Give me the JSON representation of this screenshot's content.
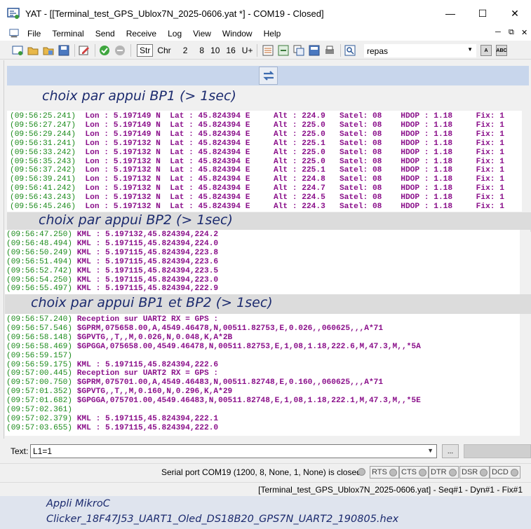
{
  "window": {
    "title": "YAT - [[Terminal_test_GPS_Ublox7N_2025-0606.yat *] - COM19 - Closed]",
    "minimize": "—",
    "maximize": "☐",
    "close": "✕"
  },
  "menu": [
    "File",
    "Terminal",
    "Send",
    "Receive",
    "Log",
    "View",
    "Window",
    "Help"
  ],
  "toolbar": {
    "str": "Str",
    "chr": "Chr",
    "radix": [
      "2",
      "8",
      "10",
      "16",
      "U+"
    ],
    "preset": "repas",
    "small_btn_a": "A",
    "small_btn_abc": "ABC"
  },
  "annotations": {
    "bp1": "choix par  appui  BP1  (> 1sec)",
    "bp2": "choix par  appui  BP2  (> 1sec)",
    "bp1bp2": "choix par  appui  BP1 et BP2   (> 1sec)"
  },
  "pane1": [
    {
      "ts": "(09:56:25.241)",
      "msg": "  Lon : 5.197149 N  Lat : 45.824394 E     Alt : 224.9   Satel: 08    HDOP : 1.18     Fix: 1"
    },
    {
      "ts": "(09:56:27.247)",
      "msg": "  Lon : 5.197149 N  Lat : 45.824394 E     Alt : 225.0   Satel: 08    HDOP : 1.18     Fix: 1"
    },
    {
      "ts": "(09:56:29.244)",
      "msg": "  Lon : 5.197149 N  Lat : 45.824394 E     Alt : 225.0   Satel: 08    HDOP : 1.18     Fix: 1"
    },
    {
      "ts": "(09:56:31.241)",
      "msg": "  Lon : 5.197132 N  Lat : 45.824394 E     Alt : 225.1   Satel: 08    HDOP : 1.18     Fix: 1"
    },
    {
      "ts": "(09:56:33.242)",
      "msg": "  Lon : 5.197132 N  Lat : 45.824394 E     Alt : 225.0   Satel: 08    HDOP : 1.18     Fix: 1"
    },
    {
      "ts": "(09:56:35.243)",
      "msg": "  Lon : 5.197132 N  Lat : 45.824394 E     Alt : 225.0   Satel: 08    HDOP : 1.18     Fix: 1"
    },
    {
      "ts": "(09:56:37.242)",
      "msg": "  Lon : 5.197132 N  Lat : 45.824394 E     Alt : 225.1   Satel: 08    HDOP : 1.18     Fix: 1"
    },
    {
      "ts": "(09:56:39.241)",
      "msg": "  Lon : 5.197132 N  Lat : 45.824394 E     Alt : 224.8   Satel: 08    HDOP : 1.18     Fix: 1"
    },
    {
      "ts": "(09:56:41.242)",
      "msg": "  Lon : 5.197132 N  Lat : 45.824394 E     Alt : 224.7   Satel: 08    HDOP : 1.18     Fix: 1"
    },
    {
      "ts": "(09:56:43.243)",
      "msg": "  Lon : 5.197132 N  Lat : 45.824394 E     Alt : 224.5   Satel: 08    HDOP : 1.18     Fix: 1"
    },
    {
      "ts": "(09:56:45.246)",
      "msg": "  Lon : 5.197132 N  Lat : 45.824394 E     Alt : 224.3   Satel: 08    HDOP : 1.18     Fix: 1"
    }
  ],
  "pane2": [
    {
      "ts": "(09:56:47.250)",
      "msg": " KML : 5.197132,45.824394,224.2"
    },
    {
      "ts": "(09:56:48.494)",
      "msg": " KML : 5.197115,45.824394,224.0"
    },
    {
      "ts": "(09:56:50.249)",
      "msg": " KML : 5.197115,45.824394,223.8"
    },
    {
      "ts": "(09:56:51.494)",
      "msg": " KML : 5.197115,45.824394,223.6"
    },
    {
      "ts": "(09:56:52.742)",
      "msg": " KML : 5.197115,45.824394,223.5"
    },
    {
      "ts": "(09:56:54.250)",
      "msg": " KML : 5.197115,45.824394,223.0"
    },
    {
      "ts": "(09:56:55.497)",
      "msg": " KML : 5.197115,45.824394,222.9"
    }
  ],
  "pane3": [
    {
      "ts": "(09:56:57.240)",
      "msg": " Reception sur UART2 RX = GPS :"
    },
    {
      "ts": "(09:56:57.546)",
      "msg": " $GPRM,075658.00,A,4549.46478,N,00511.82753,E,0.026,,060625,,,A*71"
    },
    {
      "ts": "(09:56:58.148)",
      "msg": " $GPVTG,,T,,M,0.026,N,0.048,K,A*2B"
    },
    {
      "ts": "(09:56:58.469)",
      "msg": " $GPGGA,075658.00,4549.46478,N,00511.82753,E,1,08,1.18,222.6,M,47.3,M,,*5A"
    },
    {
      "ts": "(09:56:59.157)",
      "msg": ""
    },
    {
      "ts": "(09:56:59.175)",
      "msg": " KML : 5.197115,45.824394,222.6"
    },
    {
      "ts": "(09:57:00.445)",
      "msg": " Reception sur UART2 RX = GPS :"
    },
    {
      "ts": "(09:57:00.750)",
      "msg": " $GPRM,075701.00,A,4549.46483,N,00511.82748,E,0.160,,060625,,,A*71"
    },
    {
      "ts": "(09:57:01.352)",
      "msg": " $GPVTG,,T,,M,0.160,N,0.296,K,A*29"
    },
    {
      "ts": "(09:57:01.682)",
      "msg": " $GPGGA,075701.00,4549.46483,N,00511.82748,E,1,08,1.18,222.1,M,47.3,M,,*5E"
    },
    {
      "ts": "(09:57:02.361)",
      "msg": ""
    },
    {
      "ts": "(09:57:02.379)",
      "msg": " KML : 5.197115,45.824394,222.1"
    },
    {
      "ts": "(09:57:03.655)",
      "msg": " KML : 5.197115,45.824394,222.0"
    }
  ],
  "send": {
    "label": "Text:",
    "value": "L1=1",
    "browse": "..."
  },
  "status": {
    "port": "Serial port COM19 (1200, 8, None, 1, None) is closed",
    "signals": [
      "RTS",
      "CTS",
      "DTR",
      "DSR",
      "DCD"
    ],
    "file": "[Terminal_test_GPS_Ublox7N_2025-0606.yat] - Seq#1 - Dyn#1 - Fix#1"
  },
  "bottom_note": {
    "line1": "Appli MikroC",
    "line2": "Clicker_18F47J53_UART1_Oled_DS18B20_GPS7N_UART2_190805.hex"
  },
  "colors": {
    "timestamp": "#1a8a1a",
    "message": "#8a0f8a",
    "annotation": "#1b2a6e"
  }
}
